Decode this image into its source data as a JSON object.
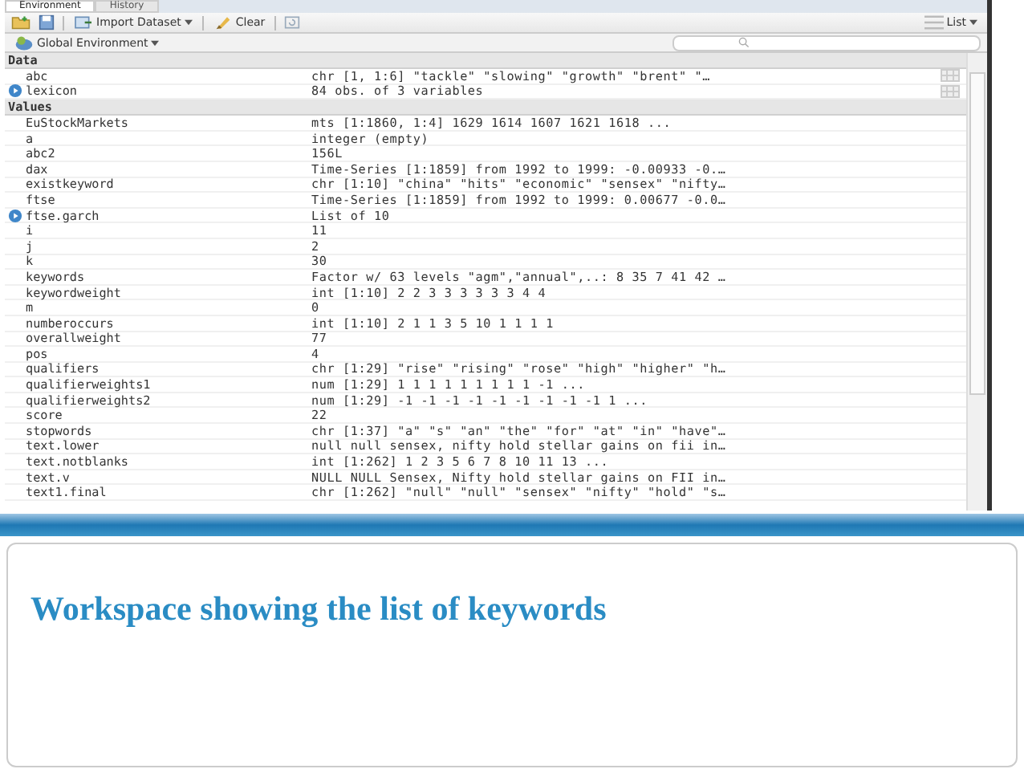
{
  "tabs": [
    {
      "label": "Environment",
      "selected": true
    },
    {
      "label": "History",
      "selected": false
    }
  ],
  "toolbar": {
    "import_label": "Import Dataset",
    "clear_label": "Clear",
    "view_label": "List"
  },
  "environment": {
    "label": "Global Environment"
  },
  "sections": [
    {
      "title": "Data",
      "rows": [
        {
          "name": "abc",
          "value": "chr [1, 1:6] \"tackle\" \"slowing\" \"growth\" \"brent\" \"…",
          "expandable": false,
          "viewable": true
        },
        {
          "name": "lexicon",
          "value": "84 obs. of 3 variables",
          "expandable": true,
          "viewable": true
        }
      ]
    },
    {
      "title": "Values",
      "rows": [
        {
          "name": "EuStockMarkets",
          "value": "mts [1:1860, 1:4] 1629 1614 1607 1621 1618 ...",
          "expandable": false,
          "viewable": false
        },
        {
          "name": "a",
          "value": "integer (empty)",
          "expandable": false,
          "viewable": false
        },
        {
          "name": "abc2",
          "value": "156L",
          "expandable": false,
          "viewable": false
        },
        {
          "name": "dax",
          "value": "Time-Series [1:1859] from 1992 to 1999: -0.00933 -0.…",
          "expandable": false,
          "viewable": false
        },
        {
          "name": "existkeyword",
          "value": "chr [1:10] \"china\" \"hits\" \"economic\" \"sensex\" \"nifty…",
          "expandable": false,
          "viewable": false
        },
        {
          "name": "ftse",
          "value": "Time-Series [1:1859] from 1992 to 1999: 0.00677 -0.0…",
          "expandable": false,
          "viewable": false
        },
        {
          "name": "ftse.garch",
          "value": "List of 10",
          "expandable": true,
          "viewable": false
        },
        {
          "name": "i",
          "value": "11",
          "expandable": false,
          "viewable": false
        },
        {
          "name": "j",
          "value": "2",
          "expandable": false,
          "viewable": false
        },
        {
          "name": "k",
          "value": "30",
          "expandable": false,
          "viewable": false
        },
        {
          "name": "keywords",
          "value": "Factor w/ 63 levels \"agm\",\"annual\",..: 8 35 7 41 42 …",
          "expandable": false,
          "viewable": false
        },
        {
          "name": "keywordweight",
          "value": "int [1:10] 2 2 3 3 3 3 3 3 4 4",
          "expandable": false,
          "viewable": false
        },
        {
          "name": "m",
          "value": "0",
          "expandable": false,
          "viewable": false
        },
        {
          "name": "numberoccurs",
          "value": "int [1:10] 2 1 1 3 5 10 1 1 1 1",
          "expandable": false,
          "viewable": false
        },
        {
          "name": "overallweight",
          "value": "77",
          "expandable": false,
          "viewable": false
        },
        {
          "name": "pos",
          "value": "4",
          "expandable": false,
          "viewable": false
        },
        {
          "name": "qualifiers",
          "value": "chr [1:29] \"rise\" \"rising\" \"rose\" \"high\" \"higher\" \"h…",
          "expandable": false,
          "viewable": false
        },
        {
          "name": "qualifierweights1",
          "value": "num [1:29] 1 1 1 1 1 1 1 1 1 -1 ...",
          "expandable": false,
          "viewable": false
        },
        {
          "name": "qualifierweights2",
          "value": "num [1:29] -1 -1 -1 -1 -1 -1 -1 -1 -1 1 ...",
          "expandable": false,
          "viewable": false
        },
        {
          "name": "score",
          "value": "22",
          "expandable": false,
          "viewable": false
        },
        {
          "name": "stopwords",
          "value": "chr [1:37] \"a\" \"s\" \"an\" \"the\" \"for\" \"at\" \"in\" \"have\"…",
          "expandable": false,
          "viewable": false
        },
        {
          "name": "text.lower",
          "value": "null null sensex, nifty hold stellar gains on fii in…",
          "expandable": false,
          "viewable": false
        },
        {
          "name": "text.notblanks",
          "value": "int [1:262] 1 2 3 5 6 7 8 10 11 13 ...",
          "expandable": false,
          "viewable": false
        },
        {
          "name": "text.v",
          "value": "NULL NULL Sensex, Nifty hold stellar gains on FII in…",
          "expandable": false,
          "viewable": false
        },
        {
          "name": "text1.final",
          "value": "chr [1:262] \"null\" \"null\" \"sensex\" \"nifty\" \"hold\" \"s…",
          "expandable": false,
          "viewable": false
        }
      ]
    }
  ],
  "slide_title": "Workspace showing the list of keywords"
}
